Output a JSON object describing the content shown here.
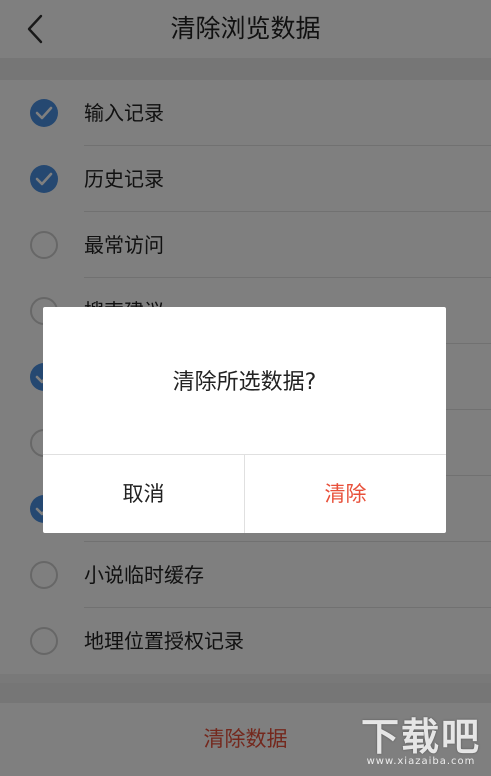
{
  "header": {
    "title": "清除浏览数据"
  },
  "items": [
    {
      "label": "输入记录",
      "checked": true
    },
    {
      "label": "历史记录",
      "checked": true
    },
    {
      "label": "最常访问",
      "checked": false
    },
    {
      "label": "搜索建议",
      "checked": false
    },
    {
      "label": "",
      "checked": true
    },
    {
      "label": "",
      "checked": false
    },
    {
      "label": "",
      "checked": true
    },
    {
      "label": "小说临时缓存",
      "checked": false
    },
    {
      "label": "地理位置授权记录",
      "checked": false
    }
  ],
  "footer": {
    "clear_label": "清除数据"
  },
  "dialog": {
    "message": "清除所选数据?",
    "cancel_label": "取消",
    "confirm_label": "清除"
  },
  "watermark": {
    "main": "下载吧",
    "sub": "www.xiazaiba.com"
  },
  "colors": {
    "accent": "#4a90e2",
    "danger": "#e8503a",
    "overlay": "rgba(0,0,0,0.5)"
  }
}
